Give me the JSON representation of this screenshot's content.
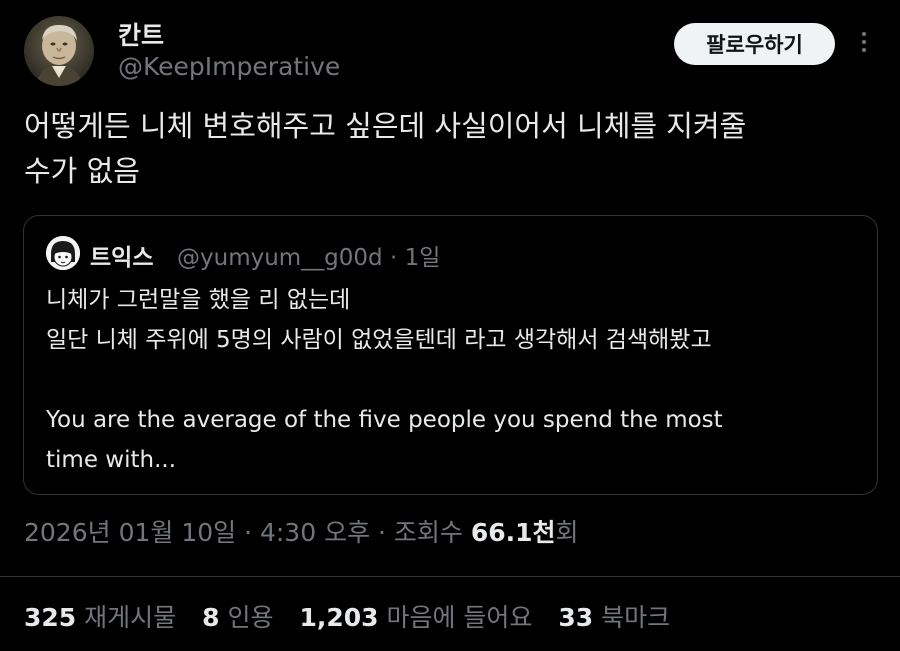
{
  "author": {
    "name": "칸트",
    "handle": "@KeepImperative",
    "avatar_icon": "portrait-avatar",
    "follow_label": "팔로우하기",
    "more_icon": "more-vertical-icon"
  },
  "tweet": {
    "text": "어떻게든 니체 변호해주고 싶은데 사실이어서 니체를 지켜줄\n수가 없음"
  },
  "quote": {
    "name": "트익스",
    "handle": "@yumyum__g00d · 1일",
    "avatar_icon": "cartoon-avatar",
    "body": "니체가 그런말을 했을 리 없는데\n일단 니체 주위에 5명의 사람이 없었을텐데 라고 생각해서 검색해봤고\n\nYou are the average of the five people you spend the most\ntime with..."
  },
  "meta": {
    "time": "2026년 01월 10일 · 4:30 오후 · 조회수 ",
    "views": "66.1천",
    "views_suffix": "회"
  },
  "stats": {
    "reposts_count": "325",
    "reposts_label": "재게시물",
    "quotes_count": "8",
    "quotes_label": "인용",
    "likes_count": "1,203",
    "likes_label": "마음에 들어요",
    "bookmarks_count": "33",
    "bookmarks_label": "북마크"
  },
  "colors": {
    "background": "#000000",
    "text": "#e7e9ea",
    "muted": "#71767b",
    "border": "#2f3336",
    "button_bg": "#eff3f4"
  }
}
